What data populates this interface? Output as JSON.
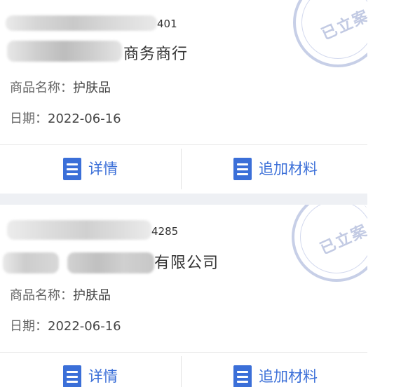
{
  "colors": {
    "accent": "#3b6fd8",
    "stamp": "#c7cfe7",
    "text": "#333333",
    "background": "#eef0f4"
  },
  "cases": [
    {
      "code_suffix": "401",
      "company_suffix": "商务商行",
      "product_label": "商品名称：",
      "product_value": "护肤品",
      "date_label": "日期：",
      "date_value": "2022-06-16",
      "stamp_text": "已立案",
      "actions": [
        {
          "label": "详情",
          "icon": "document-icon"
        },
        {
          "label": "追加材料",
          "icon": "document-icon"
        }
      ]
    },
    {
      "code_suffix": "4285",
      "company_suffix": "有限公司",
      "product_label": "商品名称：",
      "product_value": "护肤品",
      "date_label": "日期：",
      "date_value": "2022-06-16",
      "stamp_text": "已立案",
      "actions": [
        {
          "label": "详情",
          "icon": "document-icon"
        },
        {
          "label": "追加材料",
          "icon": "document-icon"
        }
      ]
    }
  ]
}
